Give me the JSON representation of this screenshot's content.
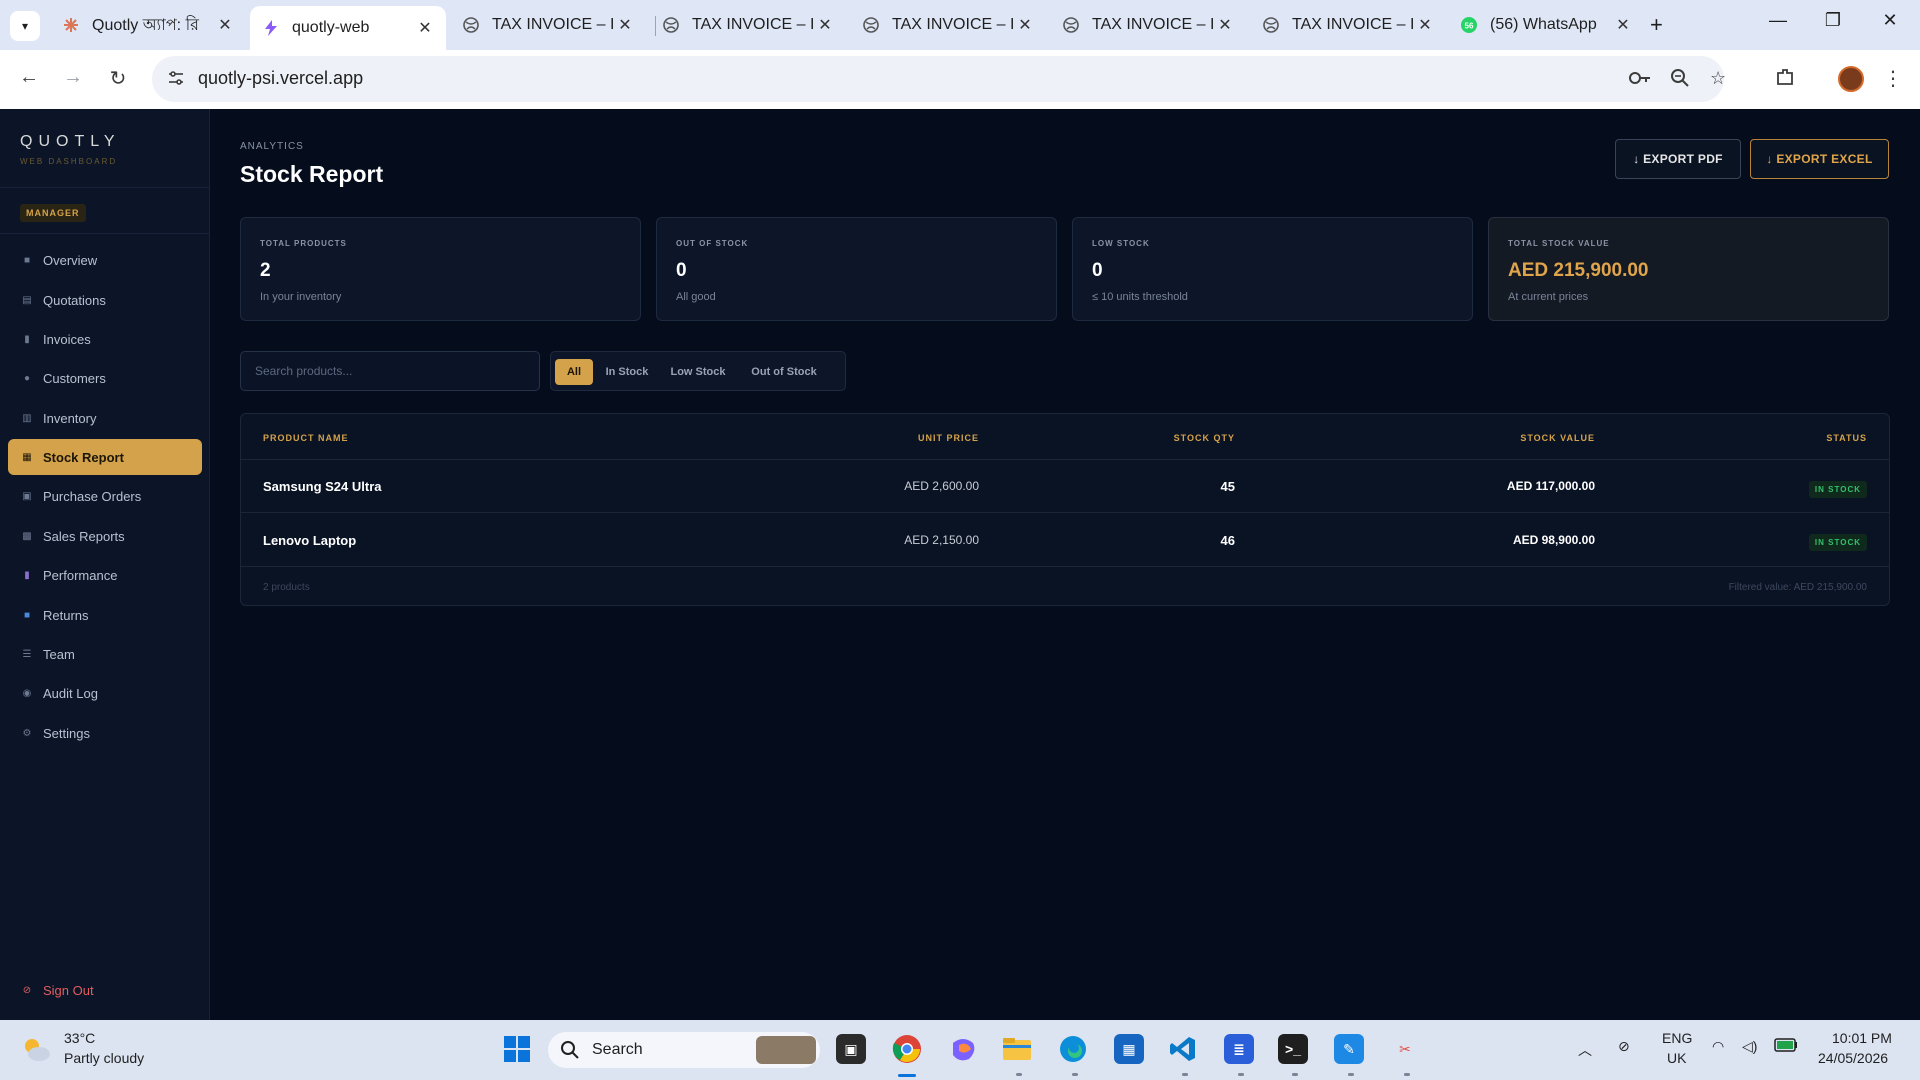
{
  "browser": {
    "tabs": [
      {
        "title": "Quotly অ্যাপ: রি",
        "icon": "claude-icon",
        "active": false
      },
      {
        "title": "quotly-web",
        "icon": "vercel-icon",
        "active": true
      },
      {
        "title": "TAX INVOICE – I",
        "icon": "globe-icon",
        "active": false
      },
      {
        "title": "TAX INVOICE – I",
        "icon": "globe-icon",
        "active": false
      },
      {
        "title": "TAX INVOICE – I",
        "icon": "globe-icon",
        "active": false
      },
      {
        "title": "TAX INVOICE – I",
        "icon": "globe-icon",
        "active": false
      },
      {
        "title": "TAX INVOICE – I",
        "icon": "globe-icon",
        "active": false
      },
      {
        "title": "(56) WhatsApp",
        "icon": "whatsapp-icon",
        "active": false
      }
    ],
    "url": "quotly-psi.vercel.app"
  },
  "sidebar": {
    "brand": "QUOTLY",
    "brand_sub": "WEB DASHBOARD",
    "role": "MANAGER",
    "items": [
      {
        "label": "Overview",
        "icon": "grid-icon"
      },
      {
        "label": "Quotations",
        "icon": "document-icon"
      },
      {
        "label": "Invoices",
        "icon": "receipt-icon"
      },
      {
        "label": "Customers",
        "icon": "user-icon"
      },
      {
        "label": "Inventory",
        "icon": "box-icon"
      },
      {
        "label": "Stock Report",
        "icon": "report-icon",
        "active": true
      },
      {
        "label": "Purchase Orders",
        "icon": "cart-icon"
      },
      {
        "label": "Sales Reports",
        "icon": "chart-icon"
      },
      {
        "label": "Performance",
        "icon": "bar-chart-icon"
      },
      {
        "label": "Returns",
        "icon": "return-icon"
      },
      {
        "label": "Team",
        "icon": "team-icon"
      },
      {
        "label": "Audit Log",
        "icon": "clock-icon"
      },
      {
        "label": "Settings",
        "icon": "gear-icon"
      }
    ],
    "signout": "Sign Out"
  },
  "page": {
    "eyebrow": "ANALYTICS",
    "title": "Stock Report",
    "export_pdf": "↓ EXPORT PDF",
    "export_excel": "↓ EXPORT EXCEL"
  },
  "stats": [
    {
      "label": "TOTAL PRODUCTS",
      "value": "2",
      "sub": "In your inventory"
    },
    {
      "label": "OUT OF STOCK",
      "value": "0",
      "sub": "All good"
    },
    {
      "label": "LOW STOCK",
      "value": "0",
      "sub": "≤ 10 units threshold"
    },
    {
      "label": "TOTAL STOCK VALUE",
      "value": "AED 215,900.00",
      "sub": "At current prices"
    }
  ],
  "search": {
    "placeholder": "Search products..."
  },
  "filters": [
    "All",
    "In Stock",
    "Low Stock",
    "Out of Stock"
  ],
  "table": {
    "headers": [
      "PRODUCT NAME",
      "UNIT PRICE",
      "STOCK QTY",
      "STOCK VALUE",
      "STATUS"
    ],
    "rows": [
      {
        "name": "Samsung S24 Ultra",
        "price": "AED 2,600.00",
        "qty": "45",
        "value": "AED 117,000.00",
        "status": "IN STOCK"
      },
      {
        "name": "Lenovo Laptop",
        "price": "AED 2,150.00",
        "qty": "46",
        "value": "AED 98,900.00",
        "status": "IN STOCK"
      }
    ],
    "footer_left": "2 products",
    "footer_right": "Filtered value: AED 215,900.00"
  },
  "taskbar": {
    "temp": "33°C",
    "weather": "Partly cloudy",
    "search": "Search",
    "lang1": "ENG",
    "lang2": "UK",
    "time": "10:01 PM",
    "date": "24/05/2026"
  },
  "colors": {
    "accent": "#d4a24a",
    "status_ok": "#33c16b",
    "danger": "#e35d5d",
    "bg": "#050d1c"
  }
}
